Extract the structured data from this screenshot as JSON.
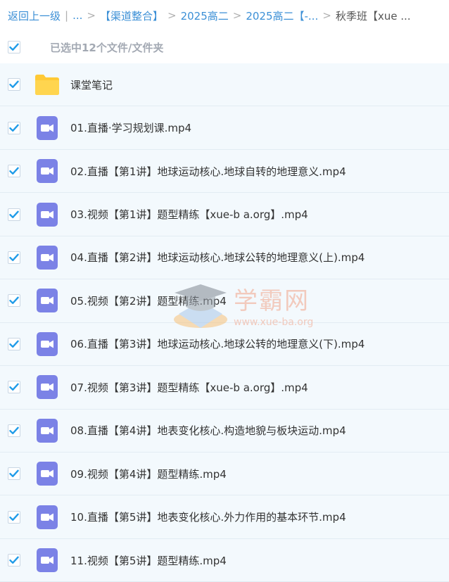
{
  "breadcrumb": {
    "back": "返回上一级",
    "divider": "|",
    "ellipsis": "...",
    "items": [
      "【渠道整合】",
      "2025高二",
      "2025高二【-...",
      "秋季班【xue ..."
    ]
  },
  "selection": {
    "text": "已选中12个文件/文件夹",
    "all_checked": true
  },
  "files": [
    {
      "name": "课堂笔记",
      "type": "folder",
      "checked": true
    },
    {
      "name": "01.直播·学习规划课.mp4",
      "type": "video",
      "checked": true
    },
    {
      "name": "02.直播【第1讲】地球运动核心.地球自转的地理意义.mp4",
      "type": "video",
      "checked": true
    },
    {
      "name": "03.视频【第1讲】题型精练【xue-b a.org】.mp4",
      "type": "video",
      "checked": true
    },
    {
      "name": "04.直播【第2讲】地球运动核心.地球公转的地理意义(上).mp4",
      "type": "video",
      "checked": true
    },
    {
      "name": "05.视频【第2讲】题型精练.mp4",
      "type": "video",
      "checked": true
    },
    {
      "name": "06.直播【第3讲】地球运动核心.地球公转的地理意义(下).mp4",
      "type": "video",
      "checked": true
    },
    {
      "name": "07.视频【第3讲】题型精练【xue-b a.org】.mp4",
      "type": "video",
      "checked": true
    },
    {
      "name": "08.直播【第4讲】地表变化核心.构造地貌与板块运动.mp4",
      "type": "video",
      "checked": true
    },
    {
      "name": "09.视频【第4讲】题型精练.mp4",
      "type": "video",
      "checked": true
    },
    {
      "name": "10.直播【第5讲】地表变化核心.外力作用的基本环节.mp4",
      "type": "video",
      "checked": true
    },
    {
      "name": "11.视频【第5讲】题型精练.mp4",
      "type": "video",
      "checked": true
    }
  ],
  "watermark": {
    "title": "学霸网",
    "url": "www.xue-ba.org"
  },
  "colors": {
    "link": "#3b8fd6",
    "check": "#1f9be8",
    "video_icon": "#7b82e6",
    "folder_icon": "#ffc935",
    "row_bg": "#f3f9fd",
    "watermark": "#f2a58a"
  }
}
